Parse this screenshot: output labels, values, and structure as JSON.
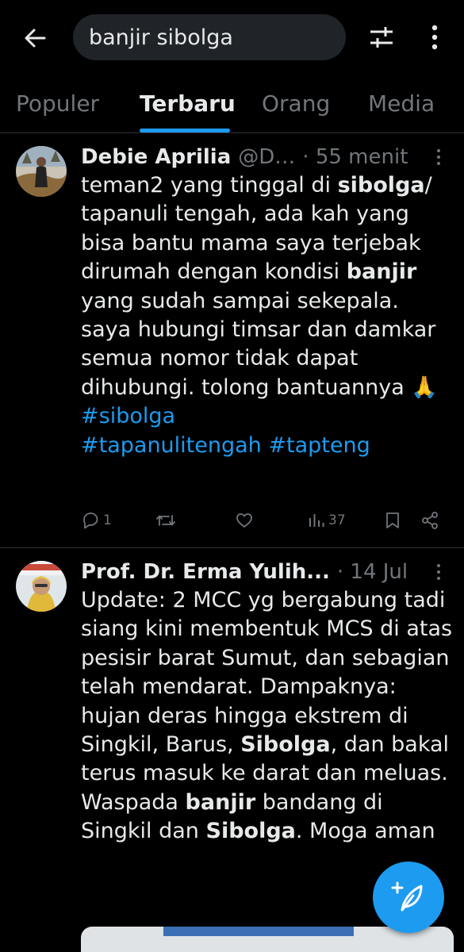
{
  "search": {
    "query": "banjir sibolga"
  },
  "tabs": [
    {
      "label": "Populer"
    },
    {
      "label": "Terbaru"
    },
    {
      "label": "Orang"
    },
    {
      "label": "Media"
    }
  ],
  "posts": [
    {
      "author": "Debie Aprilia",
      "handle": "@D…",
      "time": "· 55 menit",
      "text_parts": {
        "p1": "teman2 yang tinggal di ",
        "k1": "sibolga",
        "p2": "/ tapanuli tengah, ada kah yang bisa bantu mama saya terjebak dirumah dengan kondisi ",
        "k2": "banjir",
        "p3": " yang sudah sampai sekepala. saya hubungi timsar dan damkar semua nomor tidak dapat dihubungi. tolong bantuannya 🙏 ",
        "h1": "#sibolga",
        "h2": "#tapanulitengah",
        "h3": "#tapteng"
      },
      "replies": "1",
      "reposts": "",
      "likes": "",
      "views": "37"
    },
    {
      "author": "Prof. Dr. Erma Yulih...",
      "time": "· 14 Jul",
      "text_parts": {
        "p1": "Update: 2 MCC yg bergabung tadi siang kini membentuk MCS di atas pesisir barat Sumut, dan sebagian telah mendarat. Dampaknya: hujan deras hingga ekstrem di Singkil, Barus, ",
        "k1": "Sibolga",
        "p2": ", dan bakal terus masuk ke darat dan meluas. Waspada ",
        "k2": "banjir",
        "p3": " bandang di Singkil dan ",
        "k3": "Sibolga",
        "p4": ". Moga aman"
      }
    }
  ],
  "colors": {
    "accent": "#1d9bf0",
    "background": "#000000",
    "text": "#e7e9ea",
    "muted": "#71767b"
  },
  "icons": [
    "back-arrow-icon",
    "filter-sliders-icon",
    "more-vertical-icon",
    "reply-icon",
    "repost-icon",
    "like-icon",
    "views-icon",
    "bookmark-icon",
    "share-icon",
    "compose-post-icon"
  ]
}
